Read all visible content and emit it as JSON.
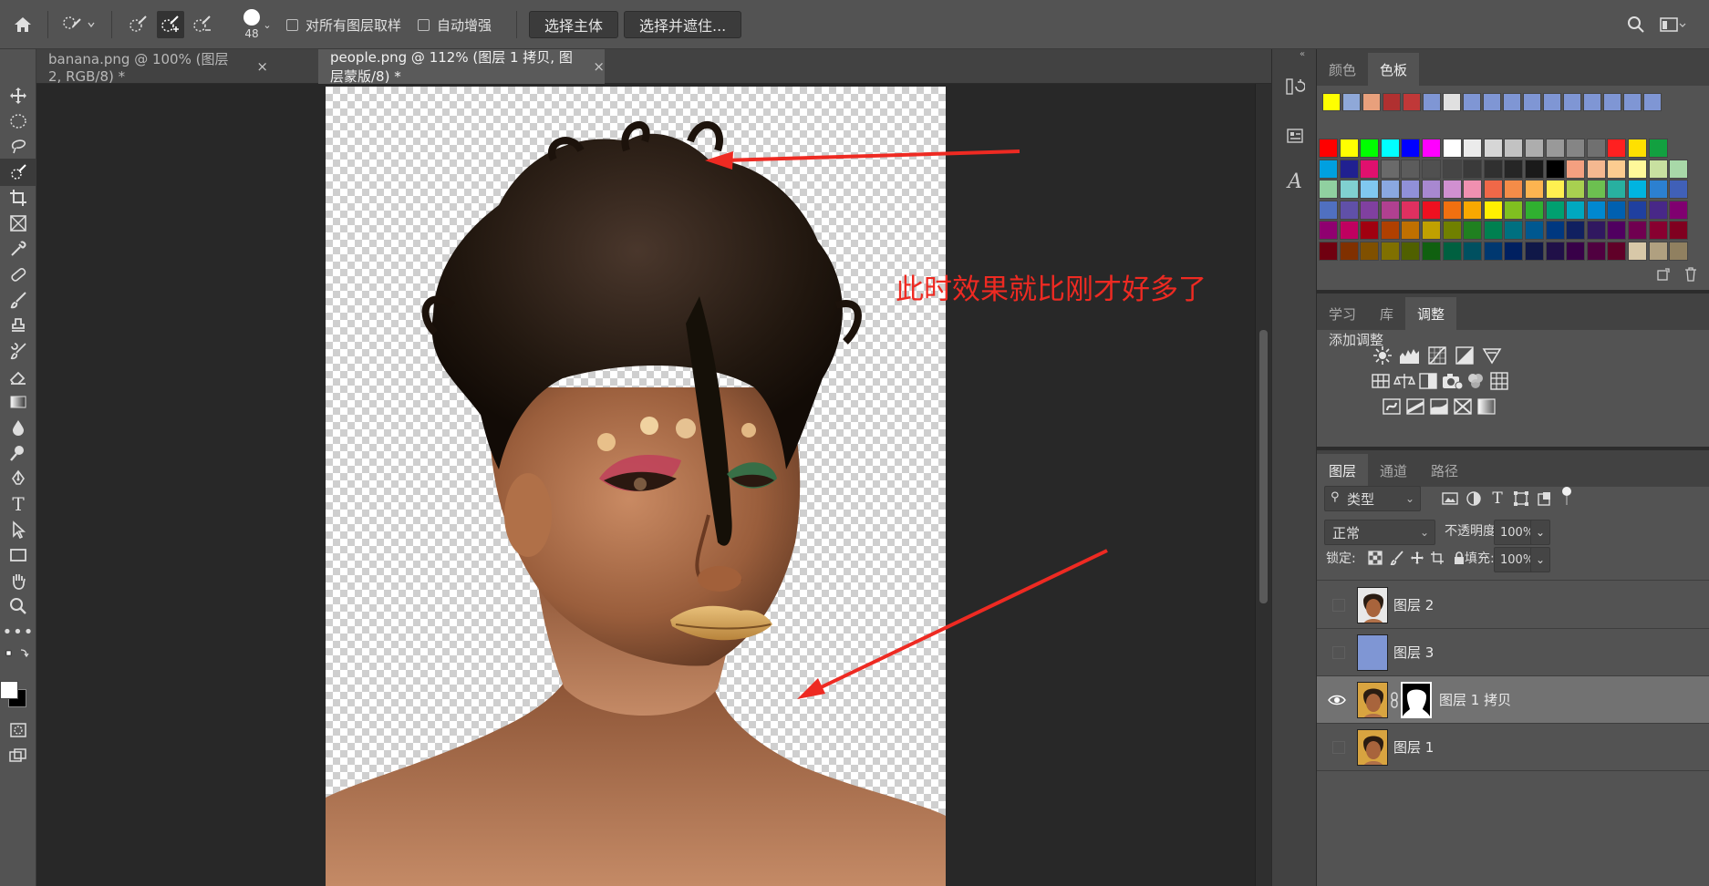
{
  "options_bar": {
    "brush_size": "48",
    "sample_all_layers": "对所有图层取样",
    "auto_enhance": "自动增强",
    "select_subject": "选择主体",
    "select_and_mask": "选择并遮住..."
  },
  "tabs": [
    {
      "label": "banana.png @ 100% (图层 2, RGB/8) *",
      "close": "×"
    },
    {
      "label": "people.png @ 112% (图层 1 拷贝, 图层蒙版/8) *",
      "close": "×"
    }
  ],
  "annotation": {
    "text": "此时效果就比刚才好多了",
    "color": "#ee2a22"
  },
  "color_panel": {
    "tabs": [
      "颜色",
      "色板"
    ],
    "active_tab": "色板",
    "recent_swatches": [
      "#ffff00",
      "#8fa8d8",
      "#e8a07c",
      "#b03030",
      "#c03838",
      "#7f96d4",
      "#e0e0e0",
      "#7f96d4",
      "#7f96d4",
      "#7f96d4",
      "#7f96d4",
      "#7f96d4",
      "#7f96d4",
      "#7f96d4",
      "#7f96d4",
      "#7f96d4",
      "#7f96d4"
    ],
    "swatch_rows": [
      [
        "#ff0000",
        "#ffff00",
        "#00ff00",
        "#00ffff",
        "#0000ff",
        "#ff00ff",
        "#ffffff",
        "#ebebeb",
        "#d6d6d6",
        "#c2c2c2",
        "#adadad",
        "#999999",
        "#858585",
        "#707070",
        "#ff2020",
        "#ffe000",
        "#12a040"
      ],
      [
        "#00a0e0",
        "#202090",
        "#e0106e",
        "#6a6a6a",
        "#5c5c5c",
        "#505050",
        "#454545",
        "#3a3a3a",
        "#303030",
        "#262626",
        "#1a1a1a",
        "#000000",
        "#f4a080",
        "#f4b890",
        "#fccc90",
        "#fff89a",
        "#c8e0a0",
        "#a8d8a8"
      ],
      [
        "#90d0a0",
        "#80d0d0",
        "#80c8f0",
        "#8aa8e0",
        "#9090d8",
        "#a888d0",
        "#d090d0",
        "#f090b0",
        "#f06848",
        "#f48c48",
        "#fcb450",
        "#fff050",
        "#a8d050",
        "#6cc050",
        "#28b0a0",
        "#00b4e0",
        "#2c80d0",
        "#4060b8"
      ],
      [
        "#5070c0",
        "#6050a8",
        "#8040a0",
        "#b04090",
        "#e03060",
        "#ee1020",
        "#f07010",
        "#f8a800",
        "#fff000",
        "#80c020",
        "#30b030",
        "#00a070",
        "#00a8c0",
        "#0088d0",
        "#0060b0",
        "#2040a0",
        "#482888",
        "#800070"
      ],
      [
        "#900070",
        "#c00060",
        "#a00010",
        "#b04000",
        "#c07000",
        "#c0a000",
        "#708000",
        "#208020",
        "#008050",
        "#007080",
        "#005890",
        "#003880",
        "#102060",
        "#301860",
        "#500060",
        "#700050",
        "#880030",
        "#800020"
      ],
      [
        "#700010",
        "#803000",
        "#805000",
        "#807000",
        "#506000",
        "#106010",
        "#006040",
        "#005060",
        "#003870",
        "#002060",
        "#101848",
        "#201048",
        "#380048",
        "#500040",
        "#600028",
        "#d8c8a8",
        "#b0a080",
        "#908060"
      ]
    ]
  },
  "adjust_panel": {
    "tabs": [
      "学习",
      "库",
      "调整"
    ],
    "active_tab": "调整",
    "title": "添加调整",
    "icons_row1": [
      "brightness-icon",
      "levels-icon",
      "curves-icon",
      "exposure-icon",
      "vibrance-icon"
    ],
    "icons_row2": [
      "hue-saturation-icon",
      "color-balance-icon",
      "black-white-icon",
      "photo-filter-icon",
      "channel-mixer-icon",
      "color-lookup-icon"
    ],
    "icons_row3": [
      "invert-icon",
      "posterize-icon",
      "threshold-icon",
      "selective-color-icon",
      "gradient-map-icon"
    ]
  },
  "layers_panel": {
    "tabs": [
      "图层",
      "通道",
      "路径"
    ],
    "active_tab": "图层",
    "filter_type": "类型",
    "blend_mode": "正常",
    "opacity_label": "不透明度:",
    "opacity_value": "100%",
    "lock_label": "锁定:",
    "fill_label": "填充:",
    "fill_value": "100%",
    "layers": [
      {
        "name": "图层 2",
        "visible": false,
        "thumb": "portrait"
      },
      {
        "name": "图层 3",
        "visible": false,
        "thumb": "blue"
      },
      {
        "name": "图层 1 拷贝",
        "visible": true,
        "thumb": "portrait",
        "mask": true,
        "selected": true
      },
      {
        "name": "图层 1",
        "visible": false,
        "thumb": "portrait"
      }
    ]
  }
}
